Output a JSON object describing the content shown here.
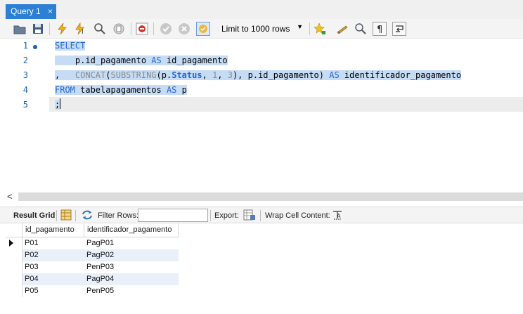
{
  "tabs": [
    {
      "label": "Query 1",
      "close_glyph": "×"
    }
  ],
  "toolbar": {
    "limit_label": "Limit to 1000 rows",
    "icons": [
      "open-file-icon",
      "save-icon",
      "execute-icon",
      "execute-current-icon",
      "explain-icon",
      "stop-icon",
      "toggle-error-icon",
      "commit-icon",
      "rollback-icon",
      "autocommit-icon",
      "beautify-icon",
      "snippet-icon",
      "find-icon",
      "invisible-chars-icon",
      "wrap-icon"
    ]
  },
  "editor": {
    "line_numbers": [
      "1",
      "2",
      "3",
      "4",
      "5"
    ],
    "lines": [
      [
        {
          "t": "SELECT",
          "c": "kw"
        }
      ],
      [
        {
          "t": "    p.id_pagamento ",
          "c": ""
        },
        {
          "t": "AS",
          "c": "kw"
        },
        {
          "t": " id_pagamento",
          "c": ""
        }
      ],
      [
        {
          "t": ",   ",
          "c": ""
        },
        {
          "t": "CONCAT",
          "c": "fn"
        },
        {
          "t": "(",
          "c": ""
        },
        {
          "t": "SUBSTRING",
          "c": "fn"
        },
        {
          "t": "(p.",
          "c": ""
        },
        {
          "t": "Status",
          "c": "col"
        },
        {
          "t": ", ",
          "c": ""
        },
        {
          "t": "1",
          "c": "num"
        },
        {
          "t": ", ",
          "c": ""
        },
        {
          "t": "3",
          "c": "num"
        },
        {
          "t": "), p.id_pagamento) ",
          "c": ""
        },
        {
          "t": "AS",
          "c": "kw"
        },
        {
          "t": " identificador_pagamento",
          "c": ""
        }
      ],
      [
        {
          "t": "FROM",
          "c": "kw"
        },
        {
          "t": " tabelapagamentos ",
          "c": ""
        },
        {
          "t": "AS",
          "c": "kw"
        },
        {
          "t": " p",
          "c": ""
        }
      ],
      [
        {
          "t": ";",
          "c": ""
        }
      ]
    ]
  },
  "scrollbar": {
    "left_arrow": "<"
  },
  "results_toolbar": {
    "result_grid_label": "Result Grid",
    "filter_rows_label": "Filter Rows:",
    "filter_value": "",
    "export_label": "Export:",
    "wrap_label": "Wrap Cell Content:"
  },
  "grid": {
    "columns": [
      "id_pagamento",
      "identificador_pagamento"
    ],
    "rows": [
      [
        "P01",
        "PagP01"
      ],
      [
        "P02",
        "PagP02"
      ],
      [
        "P03",
        "PenP03"
      ],
      [
        "P04",
        "PagP04"
      ],
      [
        "P05",
        "PenP05"
      ]
    ]
  },
  "colors": {
    "accent": "#2b7fd5",
    "selection": "#c6dcf5",
    "keyword": "#2466d6",
    "alt_row": "#e9f0fa"
  }
}
